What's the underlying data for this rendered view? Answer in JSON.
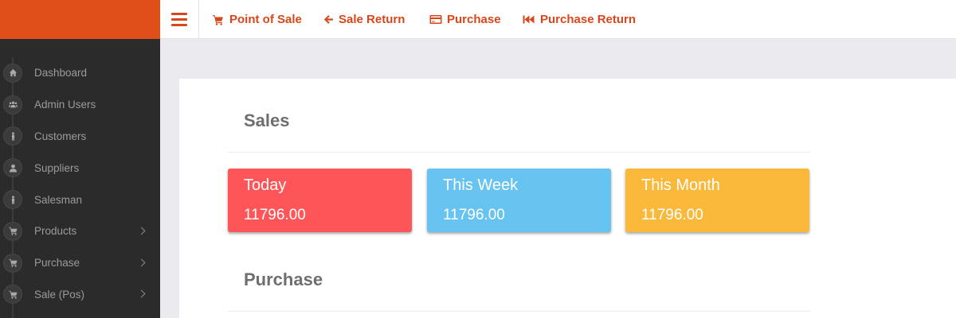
{
  "sidebar": {
    "items": [
      {
        "label": "Dashboard",
        "icon": "home-icon",
        "has_submenu": false
      },
      {
        "label": "Admin Users",
        "icon": "users-icon",
        "has_submenu": false
      },
      {
        "label": "Customers",
        "icon": "person-icon",
        "has_submenu": false
      },
      {
        "label": "Suppliers",
        "icon": "user-icon",
        "has_submenu": false
      },
      {
        "label": "Salesman",
        "icon": "person-icon",
        "has_submenu": false
      },
      {
        "label": "Products",
        "icon": "cart-icon",
        "has_submenu": true
      },
      {
        "label": "Purchase",
        "icon": "cart-icon",
        "has_submenu": true
      },
      {
        "label": "Sale (Pos)",
        "icon": "cart-icon",
        "has_submenu": true
      }
    ]
  },
  "topnav": {
    "pos": "Point of Sale",
    "sale_return": "Sale Return",
    "purchase": "Purchase",
    "purchase_return": "Purchase Return"
  },
  "sales": {
    "title": "Sales",
    "cards": [
      {
        "label": "Today",
        "value": "11796.00",
        "color": "#fe5558"
      },
      {
        "label": "This Week",
        "value": "11796.00",
        "color": "#67c3f0"
      },
      {
        "label": "This Month",
        "value": "11796.00",
        "color": "#fab93b"
      }
    ]
  },
  "purchase": {
    "title": "Purchase"
  },
  "colors": {
    "brand": "#e04e19",
    "accent": "#d8461a",
    "sidebar_bg": "#2b2b2b"
  }
}
